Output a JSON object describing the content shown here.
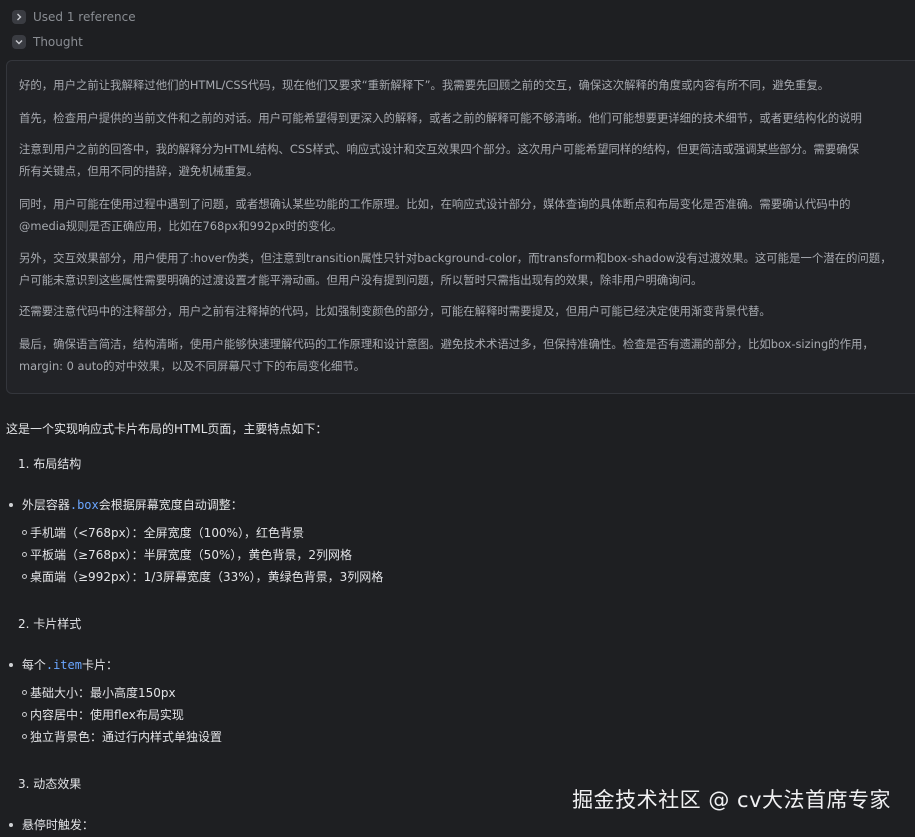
{
  "header": {
    "references_label": "Used 1 reference",
    "thought_label": "Thought"
  },
  "thought": {
    "paragraphs": [
      [
        "好的，用户之前让我解释过他们的HTML/CSS代码，现在他们又要求“重新解释下”。我需要先回顾之前的交互，确保这次解释的角度或内容有所不同，避免重复。"
      ],
      [
        "首先，检查用户提供的当前文件和之前的对话。用户可能希望得到更深入的解释，或者之前的解释可能不够清晰。他们可能想要更详细的技术细节，或者更结构化的说明"
      ],
      [
        "注意到用户之前的回答中，我的解释分为HTML结构、CSS样式、响应式设计和交互效果四个部分。这次用户可能希望同样的结构，但更简洁或强调某些部分。需要确保",
        "所有关键点，但用不同的措辞，避免机械重复。"
      ],
      [
        "同时，用户可能在使用过程中遇到了问题，或者想确认某些功能的工作原理。比如，在响应式设计部分，媒体查询的具体断点和布局变化是否准确。需要确认代码中的",
        "@media规则是否正确应用，比如在768px和992px时的变化。"
      ],
      [
        "另外，交互效果部分，用户使用了:hover伪类，但注意到transition属性只针对background-color，而transform和box-shadow没有过渡效果。这可能是一个潜在的问题，",
        "户可能未意识到这些属性需要明确的过渡设置才能平滑动画。但用户没有提到问题，所以暂时只需指出现有的效果，除非用户明确询问。"
      ],
      [
        "还需要注意代码中的注释部分，用户之前有注释掉的代码，比如强制变颜色的部分，可能在解释时需要提及，但用户可能已经决定使用渐变背景代替。"
      ],
      [
        "最后，确保语言简洁，结构清晰，使用户能够快速理解代码的工作原理和设计意图。避免技术术语过多，但保持准确性。检查是否有遗漏的部分，比如box-sizing的作用，",
        "margin: 0 auto的对中效果，以及不同屏幕尺寸下的布局变化细节。"
      ]
    ]
  },
  "answer": {
    "intro": "这是一个实现响应式卡片布局的HTML页面，主要特点如下：",
    "sections": [
      {
        "heading": "1. 布局结构",
        "bullet_prefix": "外层容器",
        "bullet_code": ".box",
        "bullet_suffix": "会根据屏幕宽度自动调整：",
        "subitems": [
          "手机端（<768px）：全屏宽度（100%），红色背景",
          "平板端（≥768px）：半屏宽度（50%），黄色背景，2列网格",
          "桌面端（≥992px）：1/3屏幕宽度（33%），黄绿色背景，3列网格"
        ]
      },
      {
        "heading": "2. 卡片样式",
        "bullet_prefix": "每个",
        "bullet_code": ".item",
        "bullet_suffix": "卡片：",
        "subitems": [
          "基础大小：最小高度150px",
          "内容居中：使用flex布局实现",
          "独立背景色：通过行内样式单独设置"
        ]
      },
      {
        "heading": "3. 动态效果",
        "bullet_prefix": "悬停时触发：",
        "bullet_code": "",
        "bullet_suffix": "",
        "subitems": []
      }
    ]
  },
  "watermark": "掘金技术社区 @ cv大法首席专家"
}
